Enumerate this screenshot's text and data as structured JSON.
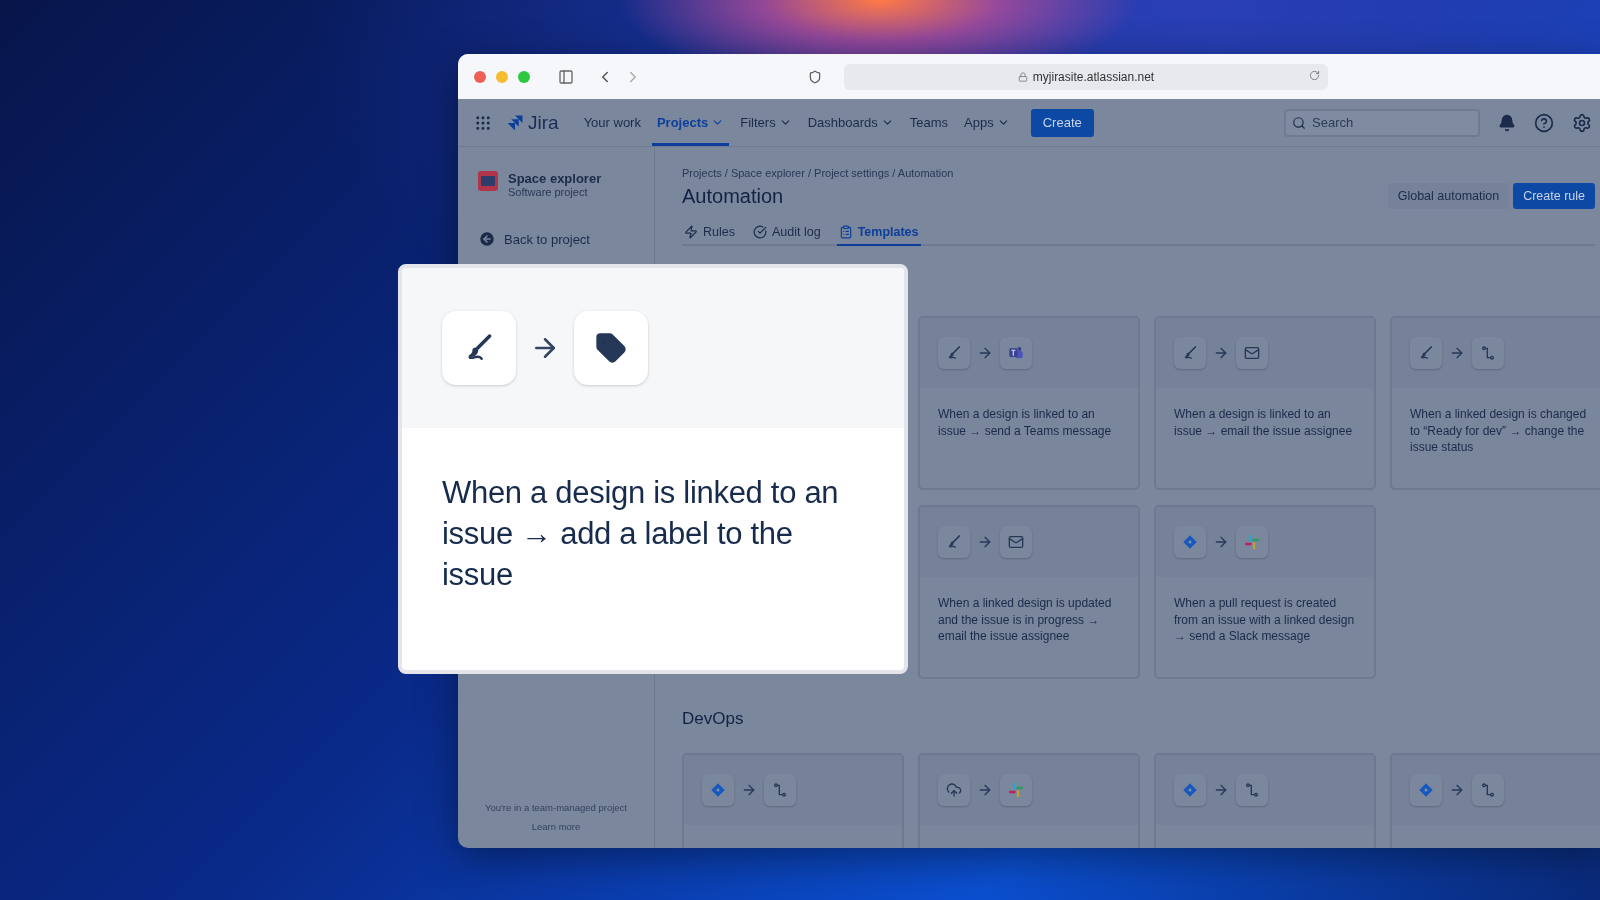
{
  "browser": {
    "url": "myjirasite.atlassian.net"
  },
  "nav": {
    "logo": "Jira",
    "items": [
      {
        "label": "Your work",
        "selected": false,
        "dropdown": false
      },
      {
        "label": "Projects",
        "selected": true,
        "dropdown": true
      },
      {
        "label": "Filters",
        "selected": false,
        "dropdown": true
      },
      {
        "label": "Dashboards",
        "selected": false,
        "dropdown": true
      },
      {
        "label": "Teams",
        "selected": false,
        "dropdown": false
      },
      {
        "label": "Apps",
        "selected": false,
        "dropdown": true
      }
    ],
    "create": "Create",
    "search": {
      "placeholder": "Search"
    }
  },
  "sidebar": {
    "project": {
      "name": "Space explorer",
      "type": "Software project"
    },
    "back": "Back to project",
    "footer": {
      "note": "You're in a team-managed project",
      "link": "Learn more"
    }
  },
  "page": {
    "breadcrumbs": "Projects / Space explorer / Project settings  / Automation",
    "title": "Automation",
    "buttons": [
      {
        "label": "Global automation",
        "kind": "secondary"
      },
      {
        "label": "Create rule",
        "kind": "primary"
      }
    ],
    "tabs": [
      {
        "label": "Rules",
        "selected": false
      },
      {
        "label": "Audit log",
        "selected": false
      },
      {
        "label": "Templates",
        "selected": true
      }
    ]
  },
  "templates": [
    {
      "icons": [
        {
          "kind": "design"
        },
        {
          "kind": "teams"
        }
      ],
      "text": "When a design is linked to an issue → send a Teams message"
    },
    {
      "icons": [
        {
          "kind": "design"
        },
        {
          "kind": "email"
        }
      ],
      "text": "When a design is linked to an issue → email the issue assignee"
    },
    {
      "icons": [
        {
          "kind": "design"
        },
        {
          "kind": "status"
        }
      ],
      "text": "When a linked design is changed to “Ready for dev” → change the issue status"
    },
    {
      "icons": [
        {
          "kind": "design"
        },
        {
          "kind": "email"
        }
      ],
      "text": "When a linked design is updated and the issue is in progress → email the issue assignee"
    },
    {
      "icons": [
        {
          "kind": "jira"
        },
        {
          "kind": "slack"
        }
      ],
      "text": "When a pull request is created from an issue with a linked design → send a Slack message"
    }
  ],
  "devops": {
    "title": "DevOps",
    "cards": [
      {
        "icons": [
          {
            "kind": "jira"
          },
          {
            "kind": "status"
          }
        ]
      },
      {
        "icons": [
          {
            "kind": "deploy"
          },
          {
            "kind": "slack"
          }
        ]
      },
      {
        "icons": [
          {
            "kind": "jira"
          },
          {
            "kind": "status"
          }
        ]
      },
      {
        "icons": [
          {
            "kind": "jira"
          },
          {
            "kind": "status"
          }
        ]
      }
    ]
  },
  "highlight": {
    "icons": [
      {
        "kind": "design"
      },
      {
        "kind": "label"
      }
    ],
    "text": "When a design is linked to an issue → add a label to the issue"
  }
}
